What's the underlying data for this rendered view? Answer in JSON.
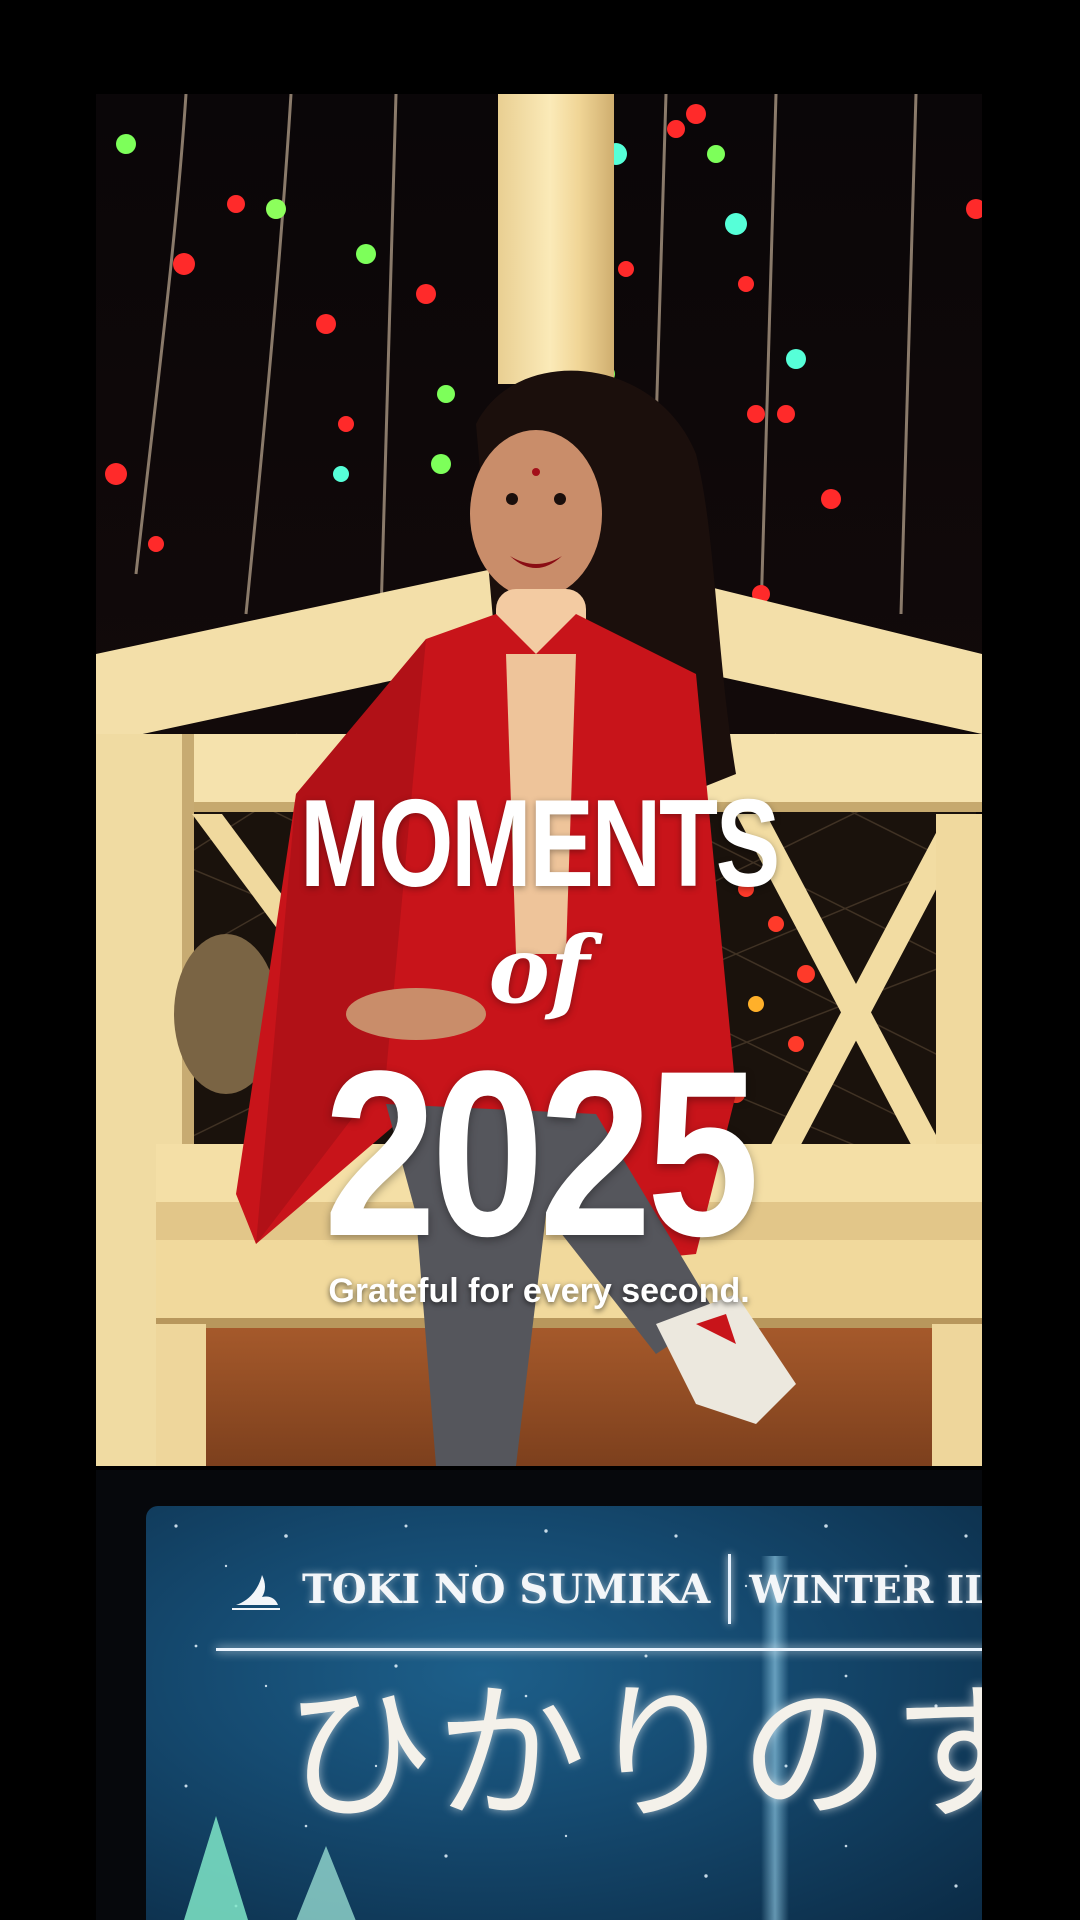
{
  "reel": {
    "title_line1": "MOMENTS",
    "title_line2": "of",
    "title_line3": "2025",
    "tagline": "Grateful for every second."
  },
  "sign": {
    "brand_name": "TOKI NO SUMIKA",
    "brand_subtitle": "WINTER ILLUM",
    "japanese_title": "ひかりのすみ",
    "icon": "bird-icon"
  },
  "colors": {
    "background": "#000000",
    "title_text": "#ffffff",
    "coat_red": "#c8141a",
    "bench_wood": "#f1dca6",
    "sign_blue": "#1d5f8a"
  }
}
